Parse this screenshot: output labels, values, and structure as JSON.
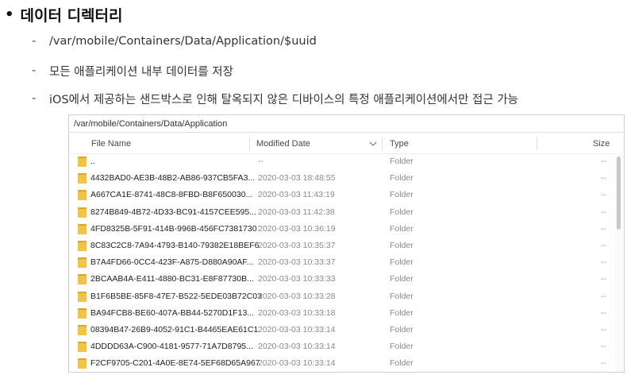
{
  "slide": {
    "heading": "데이터 디렉터리",
    "bullets": [
      "/var/mobile/Containers/Data/Application/$uuid",
      "모든 애플리케이션 내부 데이터를 저장",
      "iOS에서 제공하는 샌드박스로 인해 탈옥되지 않은 디바이스의 특정 애플리케이션에서만 접근 가능"
    ]
  },
  "explorer": {
    "path": "/var/mobile/Containers/Data/Application",
    "columns": {
      "name": "File Name",
      "modified": "Modified Date",
      "type": "Type",
      "size": "Size"
    },
    "rows": [
      {
        "name": "..",
        "modified": "--",
        "type": "Folder",
        "size": "--"
      },
      {
        "name": "4432BAD0-AE3B-48B2-AB86-937CB5FA3...",
        "modified": "2020-03-03 18:48:55",
        "type": "Folder",
        "size": "--"
      },
      {
        "name": "A667CA1E-8741-48C8-8FBD-B8F650030...",
        "modified": "2020-03-03 11:43:19",
        "type": "Folder",
        "size": "--"
      },
      {
        "name": "8274B849-4B72-4D33-BC91-4157CEE595...",
        "modified": "2020-03-03 11:42:38",
        "type": "Folder",
        "size": "--"
      },
      {
        "name": "4FD8325B-5F91-414B-996B-456FC7381730",
        "modified": "2020-03-03 10:36:19",
        "type": "Folder",
        "size": "--"
      },
      {
        "name": "8C83C2C8-7A94-4793-B140-79382E18BEF6",
        "modified": "2020-03-03 10:35:37",
        "type": "Folder",
        "size": "--"
      },
      {
        "name": "B7A4FD66-0CC4-423F-A875-D880A90AF...",
        "modified": "2020-03-03 10:33:37",
        "type": "Folder",
        "size": "--"
      },
      {
        "name": "2BCAAB4A-E411-4880-BC31-E8F87730B...",
        "modified": "2020-03-03 10:33:33",
        "type": "Folder",
        "size": "--"
      },
      {
        "name": "B1F6B5BE-85F8-47E7-B522-5EDE03B72C03",
        "modified": "2020-03-03 10:33:28",
        "type": "Folder",
        "size": "--"
      },
      {
        "name": "BA94FCB8-BE60-407A-BB44-5270D1F13...",
        "modified": "2020-03-03 10:33:18",
        "type": "Folder",
        "size": "--"
      },
      {
        "name": "08394B47-26B9-4052-91C1-B4465EAE61C1",
        "modified": "2020-03-03 10:33:14",
        "type": "Folder",
        "size": "--"
      },
      {
        "name": "4DDDD63A-C900-4181-9577-71A7D8795...",
        "modified": "2020-03-03 10:33:14",
        "type": "Folder",
        "size": "--"
      },
      {
        "name": "F2CF9705-C201-4A0E-8E74-5EF68D65A967",
        "modified": "2020-03-03 10:33:14",
        "type": "Folder",
        "size": "--"
      }
    ],
    "colors": {
      "folder": "#f0c34a",
      "folder_dark": "#dba72f",
      "border": "#cfcfcf"
    },
    "icons": {
      "folder": "folder-icon",
      "sort": "chevron-down-icon"
    }
  }
}
